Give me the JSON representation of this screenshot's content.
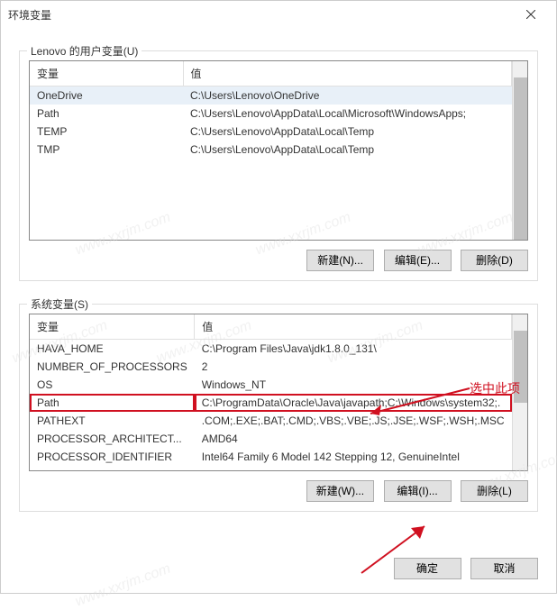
{
  "dialogTitle": "环境变量",
  "userGroup": {
    "label": "Lenovo 的用户变量(U)",
    "headers": {
      "variable": "变量",
      "value": "值"
    },
    "rows": [
      {
        "variable": "OneDrive",
        "value": "C:\\Users\\Lenovo\\OneDrive"
      },
      {
        "variable": "Path",
        "value": "C:\\Users\\Lenovo\\AppData\\Local\\Microsoft\\WindowsApps;"
      },
      {
        "variable": "TEMP",
        "value": "C:\\Users\\Lenovo\\AppData\\Local\\Temp"
      },
      {
        "variable": "TMP",
        "value": "C:\\Users\\Lenovo\\AppData\\Local\\Temp"
      }
    ],
    "buttons": {
      "new": "新建(N)...",
      "edit": "编辑(E)...",
      "del": "删除(D)"
    }
  },
  "systemGroup": {
    "label": "系统变量(S)",
    "headers": {
      "variable": "变量",
      "value": "值"
    },
    "rows": [
      {
        "variable": "HAVA_HOME",
        "value": "C:\\Program Files\\Java\\jdk1.8.0_131\\"
      },
      {
        "variable": "NUMBER_OF_PROCESSORS",
        "value": "2"
      },
      {
        "variable": "OS",
        "value": "Windows_NT"
      },
      {
        "variable": "Path",
        "value": "C:\\ProgramData\\Oracle\\Java\\javapath;C:\\Windows\\system32;."
      },
      {
        "variable": "PATHEXT",
        "value": ".COM;.EXE;.BAT;.CMD;.VBS;.VBE;.JS;.JSE;.WSF;.WSH;.MSC"
      },
      {
        "variable": "PROCESSOR_ARCHITECT...",
        "value": "AMD64"
      },
      {
        "variable": "PROCESSOR_IDENTIFIER",
        "value": "Intel64 Family 6 Model 142 Stepping 12, GenuineIntel"
      }
    ],
    "buttons": {
      "new": "新建(W)...",
      "edit": "编辑(I)...",
      "del": "删除(L)"
    }
  },
  "mainButtons": {
    "ok": "确定",
    "cancel": "取消"
  },
  "annotation": "选中此项",
  "watermark": "www.xxrjm.com"
}
